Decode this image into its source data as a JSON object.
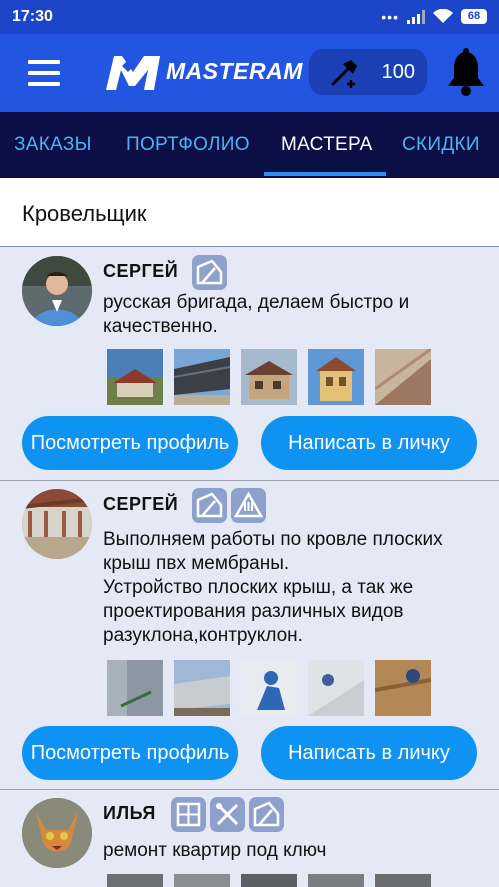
{
  "status_bar": {
    "time": "17:30",
    "signal_icon": "signal-icon",
    "wifi_icon": "wifi-icon",
    "battery": "68"
  },
  "app_bar": {
    "menu_icon": "hamburger-menu-icon",
    "logo_text": "MASTERAM",
    "credits": "100",
    "credits_icon": "hammer-plus-icon",
    "notifications_icon": "bell-icon",
    "colors": {
      "background": "#2255e0",
      "status_bar": "#1d45c9"
    }
  },
  "tabs": [
    {
      "label": "ЗАКАЗЫ",
      "active": false
    },
    {
      "label": "ПОРТФОЛИО",
      "active": false
    },
    {
      "label": "МАСТЕРА",
      "active": true
    },
    {
      "label": "СКИДКИ",
      "active": false
    }
  ],
  "category": {
    "title": "Кровельщик"
  },
  "masters": [
    {
      "name": "СЕРГЕЙ",
      "skills": [
        "roof-icon"
      ],
      "description": [
        "русская бригада, делаем быстро и",
        "качественно."
      ],
      "photo_count": 5
    },
    {
      "name": "СЕРГЕЙ",
      "skills": [
        "roof-icon",
        "warning-triangle-icon"
      ],
      "description": [
        "Выполняем работы по кровле плоских",
        "крыш пвх мембраны.",
        "Устройство плоских крыш, а так же",
        "проектирования различных видов",
        "разуклона,контруклон."
      ],
      "photo_count": 5
    },
    {
      "name": "ИЛЬЯ",
      "skills": [
        "window-icon",
        "tools-icon",
        "roof-icon"
      ],
      "description": [
        "ремонт квартир под ключ"
      ],
      "photo_count": 5
    }
  ],
  "buttons": {
    "view_profile": "Посмотреть профиль",
    "write_message": "Написать в личку",
    "color": "#0f93f2"
  }
}
